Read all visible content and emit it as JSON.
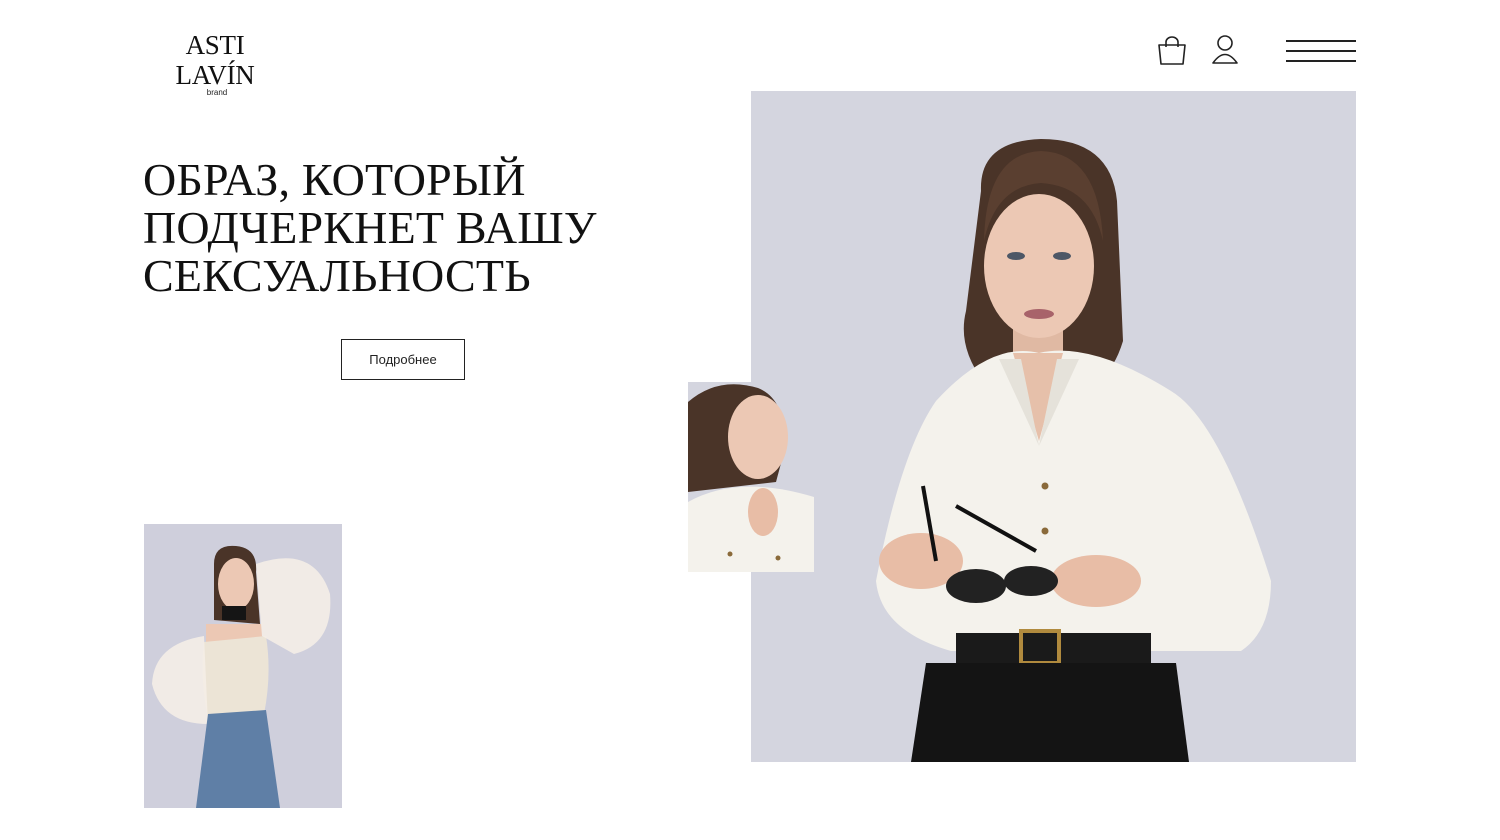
{
  "header": {
    "logo": {
      "name": "ASTI LAVÍN",
      "sub": "brand"
    },
    "icons": [
      "shopping-bag-icon",
      "user-icon",
      "menu-icon"
    ]
  },
  "hero": {
    "title_lines": [
      "ОБРАЗ, КОТОРЫЙ",
      "ПОДЧЕРКНЕТ ВАШУ",
      "СЕКСУАЛЬНОСТЬ"
    ],
    "button_label": "Подробнее"
  },
  "colors": {
    "text": "#111111",
    "photo_background": "#d4d5df",
    "blouse": "#f4f2ec",
    "trousers": "#141414"
  }
}
